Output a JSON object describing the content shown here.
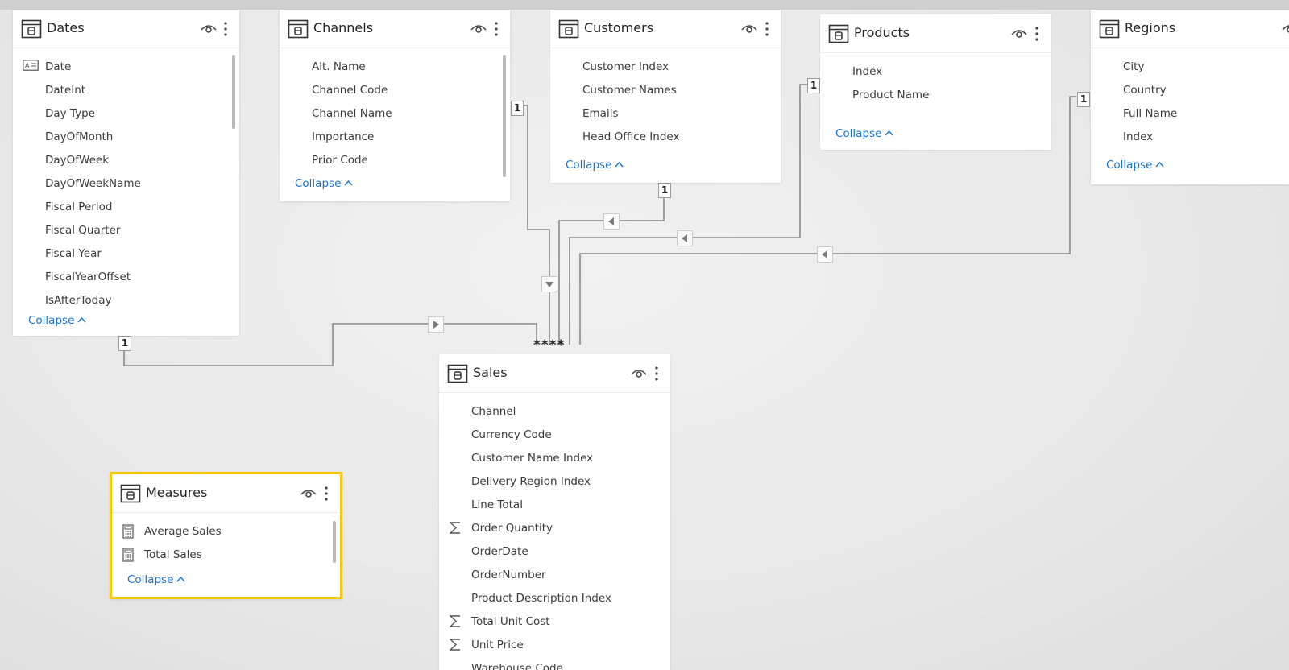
{
  "tables": {
    "dates": {
      "title": "Dates",
      "fields": [
        "Date",
        "DateInt",
        "Day Type",
        "DayOfMonth",
        "DayOfWeek",
        "DayOfWeekName",
        "Fiscal Period",
        "Fiscal Quarter",
        "Fiscal Year",
        "FiscalYearOffset",
        "IsAfterToday"
      ],
      "collapse": "Collapse"
    },
    "channels": {
      "title": "Channels",
      "fields": [
        "Alt. Name",
        "Channel Code",
        "Channel Name",
        "Importance",
        "Prior Code"
      ],
      "collapse": "Collapse"
    },
    "customers": {
      "title": "Customers",
      "fields": [
        "Customer Index",
        "Customer Names",
        "Emails",
        "Head Office Index"
      ],
      "collapse": "Collapse"
    },
    "products": {
      "title": "Products",
      "fields": [
        "Index",
        "Product Name"
      ],
      "collapse": "Collapse"
    },
    "regions": {
      "title": "Regions",
      "fields": [
        "City",
        "Country",
        "Full Name",
        "Index"
      ],
      "collapse": "Collapse"
    },
    "measures": {
      "title": "Measures",
      "fields": [
        "Average Sales",
        "Total Sales"
      ],
      "collapse": "Collapse"
    },
    "sales": {
      "title": "Sales",
      "fields": [
        "Channel",
        "Currency Code",
        "Customer Name Index",
        "Delivery Region Index",
        "Line Total",
        "Order Quantity",
        "OrderDate",
        "OrderNumber",
        "Product Description Index",
        "Total Unit Cost",
        "Unit Price",
        "Warehouse Code"
      ]
    }
  },
  "relationships": {
    "one_label": "1",
    "many_label": "****"
  },
  "colors": {
    "link": "#1a73c8",
    "selected_border": "#f2c811",
    "line": "#8a8a8a"
  },
  "icons": {
    "table": "table-icon",
    "visibility": "eye-icon",
    "more": "more-options-icon",
    "calendar": "calendar-field-icon",
    "sum": "sum-icon",
    "measure": "calculator-icon",
    "arrow": "filter-direction-arrow-icon"
  }
}
